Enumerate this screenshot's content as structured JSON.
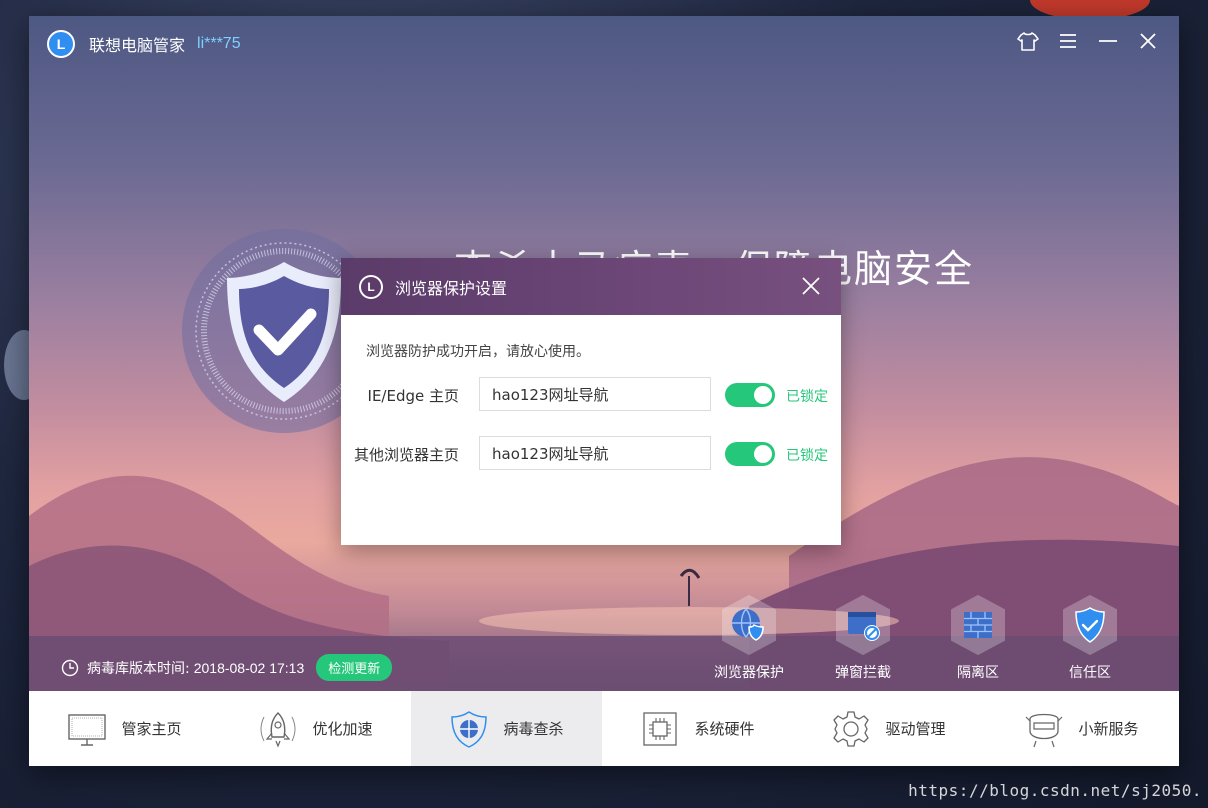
{
  "app": {
    "title": "联想电脑管家",
    "user": "li***75",
    "logo_letter": "L",
    "accent_color": "#2f8ef0"
  },
  "window_controls": [
    {
      "name": "skin-icon"
    },
    {
      "name": "menu-icon"
    },
    {
      "name": "minimize-icon"
    },
    {
      "name": "close-icon"
    }
  ],
  "hero": {
    "slogan": "查杀木马病毒，保障电脑安全"
  },
  "status": {
    "label": "病毒库版本时间:",
    "time": "2018-08-02 17:13",
    "update_button": "检测更新",
    "update_color": "#25c77a"
  },
  "tools": [
    {
      "label": "浏览器保护",
      "icon": "browser-shield-icon"
    },
    {
      "label": "弹窗拦截",
      "icon": "popup-block-icon"
    },
    {
      "label": "隔离区",
      "icon": "quarantine-wall-icon"
    },
    {
      "label": "信任区",
      "icon": "trust-shield-icon"
    }
  ],
  "nav": [
    {
      "label": "管家主页",
      "icon": "monitor-icon",
      "active": false
    },
    {
      "label": "优化加速",
      "icon": "rocket-icon",
      "active": false
    },
    {
      "label": "病毒查杀",
      "icon": "antivirus-shield-icon",
      "active": true
    },
    {
      "label": "系统硬件",
      "icon": "chip-icon",
      "active": false
    },
    {
      "label": "驱动管理",
      "icon": "gear-icon",
      "active": false
    },
    {
      "label": "小新服务",
      "icon": "service-icon",
      "active": false
    }
  ],
  "dialog": {
    "title": "浏览器保护设置",
    "message": "浏览器防护成功开启，请放心使用。",
    "rows": [
      {
        "label": "IE/Edge 主页",
        "value": "hao123网址导航",
        "locked": true,
        "lock_text": "已锁定"
      },
      {
        "label": "其他浏览器主页",
        "value": "hao123网址导航",
        "locked": true,
        "lock_text": "已锁定"
      }
    ]
  },
  "watermark": "https://blog.csdn.net/sj2050."
}
